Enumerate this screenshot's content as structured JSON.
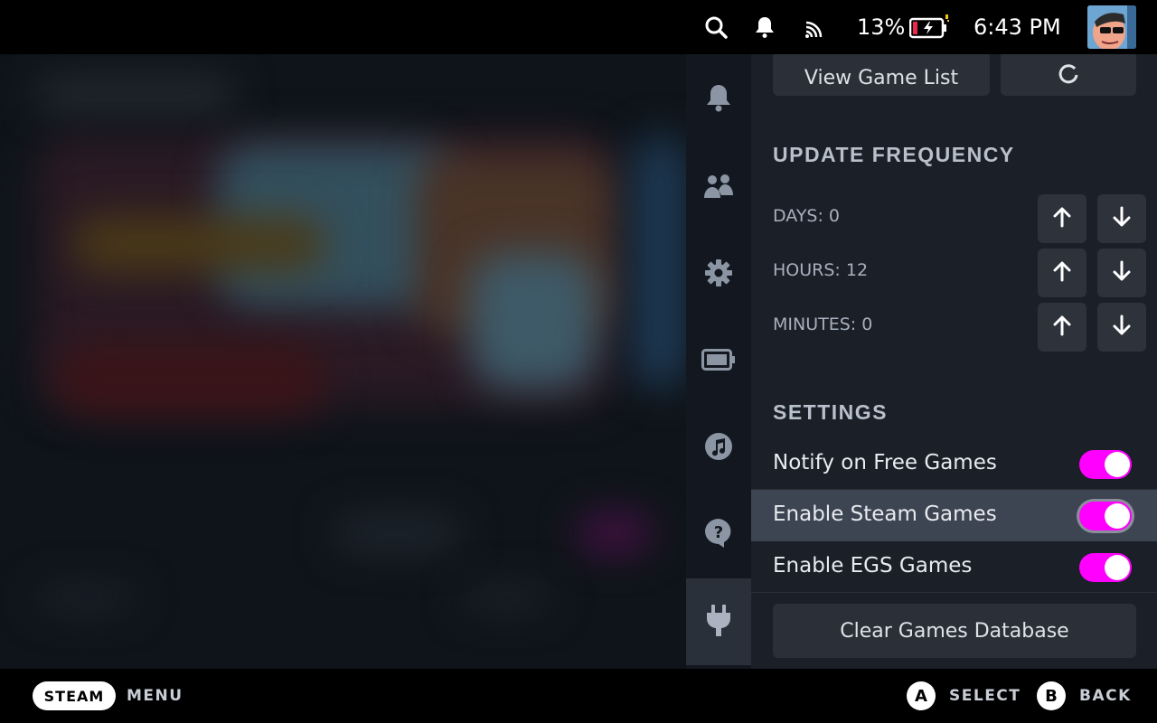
{
  "topbar": {
    "battery_percent": "13%",
    "time": "6:43 PM",
    "icons": [
      "search-icon",
      "bell-icon",
      "wifi-icon",
      "battery-charging-icon"
    ]
  },
  "sidenav": {
    "items": [
      {
        "name": "notifications",
        "icon": "bell-icon"
      },
      {
        "name": "friends",
        "icon": "friends-icon"
      },
      {
        "name": "settings",
        "icon": "gear-icon"
      },
      {
        "name": "performance",
        "icon": "battery-icon"
      },
      {
        "name": "music",
        "icon": "music-icon"
      },
      {
        "name": "help",
        "icon": "help-icon"
      },
      {
        "name": "plugins",
        "icon": "plug-icon",
        "active": true
      }
    ]
  },
  "panel": {
    "top_buttons": {
      "view_list_label": "View Game List"
    },
    "update_frequency": {
      "title": "UPDATE FREQUENCY",
      "days_label": "DAYS: 0",
      "hours_label": "HOURS: 12",
      "minutes_label": "MINUTES: 0"
    },
    "settings": {
      "title": "SETTINGS",
      "items": [
        {
          "label": "Notify on Free Games",
          "enabled": true
        },
        {
          "label": "Enable Steam Games",
          "enabled": true,
          "focused": true
        },
        {
          "label": "Enable EGS Games",
          "enabled": true
        }
      ]
    },
    "clear_button_label": "Clear Games Database"
  },
  "bottombar": {
    "steam_label": "STEAM",
    "menu_label": "MENU",
    "a_button": "A",
    "select_label": "SELECT",
    "b_button": "B",
    "back_label": "BACK"
  },
  "colors": {
    "toggle_on": "#ff00ff",
    "panel_bg": "#1a1f28",
    "focus_row": "#3d4452"
  }
}
